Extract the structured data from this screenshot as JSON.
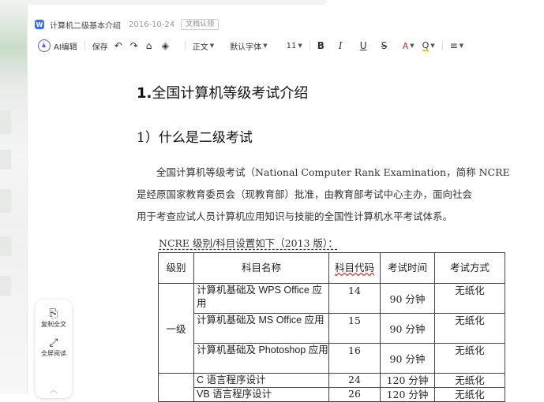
{
  "header": {
    "doc_icon": "W",
    "title": "计算机二级基本介绍",
    "date": "2016-10-24",
    "badge": "文档认领"
  },
  "toolbar": {
    "ai_label": "AI编辑",
    "save_label": "保存",
    "style_label": "正文",
    "font_label": "默认字体",
    "size_label": "11",
    "bold": "B",
    "italic": "I",
    "underline": "U",
    "strike": "S",
    "font_color": "A",
    "highlight": "Q"
  },
  "document": {
    "h1_num": "1.",
    "h1_text": "全国计算机等级考试介绍",
    "h2": "1）什么是二级考试",
    "para_lines": [
      "　　全国计算机等级考试（National Computer Rank Examination，简称 NCRE",
      "是经原国家教育委员会（现教育部）批准，由教育部考试中心主办，面向社会",
      "用于考查应试人员计算机应用知识与技能的全国性计算机水平考试体系。"
    ],
    "caption": "NCRE 级别/科目设置如下（2013 版）："
  },
  "table": {
    "headers": [
      "级别",
      "科目名称",
      "科目代码",
      "考试时间",
      "考试方式"
    ],
    "level_1": "一级",
    "rows": [
      {
        "subject": "计算机基础及 WPS Office 应用",
        "code": "14",
        "time": "90 分钟",
        "mode": "无纸化"
      },
      {
        "subject": "计算机基础及 MS Office 应用",
        "code": "15",
        "time": "90 分钟",
        "mode": "无纸化"
      },
      {
        "subject": "计算机基础及 Photoshop 应用",
        "code": "16",
        "time": "90 分钟",
        "mode": "无纸化"
      },
      {
        "subject": "C 语言程序设计",
        "code": "24",
        "time": "120 分钟",
        "mode": "无纸化"
      },
      {
        "subject": "VB 语言程序设计",
        "code": "26",
        "time": "120 分钟",
        "mode": "无纸化"
      }
    ]
  },
  "side_panel": {
    "copy_label": "复制全文",
    "fullscreen_label": "全屏阅读"
  }
}
